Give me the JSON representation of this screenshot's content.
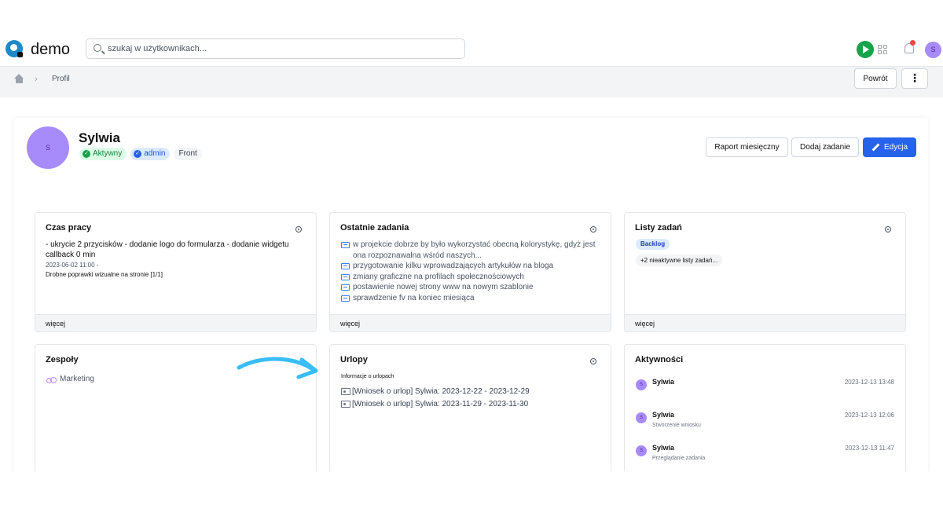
{
  "app": {
    "brand": "demo"
  },
  "search": {
    "placeholder": "szukaj w użytkownikach..."
  },
  "topbar": {
    "avatar_initial": "S",
    "notification_count": ""
  },
  "breadcrumb": {
    "current": "Profil"
  },
  "toolbar": {
    "back_label": "Powrót",
    "more_label": "⋮"
  },
  "profile": {
    "avatar_initial": "S",
    "name": "Sylwia",
    "badges": {
      "status": "Aktywny",
      "role": "admin",
      "team": "Front"
    },
    "actions": {
      "report": "Raport miesięczny",
      "add_task": "Dodaj zadanie",
      "edit": "Edycja"
    }
  },
  "cards": {
    "work_time": {
      "title": "Czas pracy",
      "entry_text": "- ukrycie 2 przycisków - dodanie logo do formularza - dodanie widgetu callback 0 min",
      "entry_date": "2023-06-02 11:00 -",
      "entry_task": "Drobne poprawki wizualne na stronie [1/1]",
      "more": "więcej"
    },
    "recent_tasks": {
      "title": "Ostatnie zadania",
      "items": [
        "w projekcie dobrze by było wykorzystać obecną kolorystykę, gdyż jest ona rozpoznawalna wśród naszych...",
        "przygotowanie kilku wprowadzających artykułów na bloga",
        "zmiany graficzne na profilach społecznościowych",
        "postawienie nowej strony www na nowym szablonie",
        "sprawdzenie fv na koniec miesiąca"
      ],
      "more": "więcej"
    },
    "task_lists": {
      "title": "Listy zadań",
      "badge": "Backlog",
      "inactive": "+2 nieaktywne listy zadań...",
      "more": "więcej"
    },
    "teams": {
      "title": "Zespoły",
      "items": [
        "Marketing"
      ]
    },
    "leaves": {
      "title": "Urlopy",
      "subtitle": "Informacje o urlopach",
      "items": [
        "[Wniosek o urlop] Sylwia: 2023-12-22 - 2023-12-29",
        "[Wniosek o urlop] Sylwia: 2023-11-29 - 2023-11-30"
      ]
    },
    "activities": {
      "title": "Aktywności",
      "items": [
        {
          "initial": "S",
          "name": "Sylwia",
          "time": "2023-12-13 13:48",
          "desc": ""
        },
        {
          "initial": "S",
          "name": "Sylwia",
          "time": "2023-12-13 12:06",
          "desc": "Stworzenie wniosku"
        },
        {
          "initial": "S",
          "name": "Sylwia",
          "time": "2023-12-13 11:47",
          "desc": "Przeglądanie zadania"
        }
      ]
    }
  },
  "colors": {
    "accent": "#2563eb",
    "status_green": "#16a34a",
    "avatar": "#a78bfa",
    "arrow": "#38bdf8"
  },
  "icons": [
    "logo-icon",
    "search-icon",
    "play-icon",
    "apps-grid-icon",
    "bell-icon",
    "home-icon",
    "chevron-right-icon",
    "check-circle-icon",
    "pencil-icon",
    "settings-icon",
    "task-icon",
    "people-icon",
    "leave-icon",
    "arrow-icon"
  ]
}
